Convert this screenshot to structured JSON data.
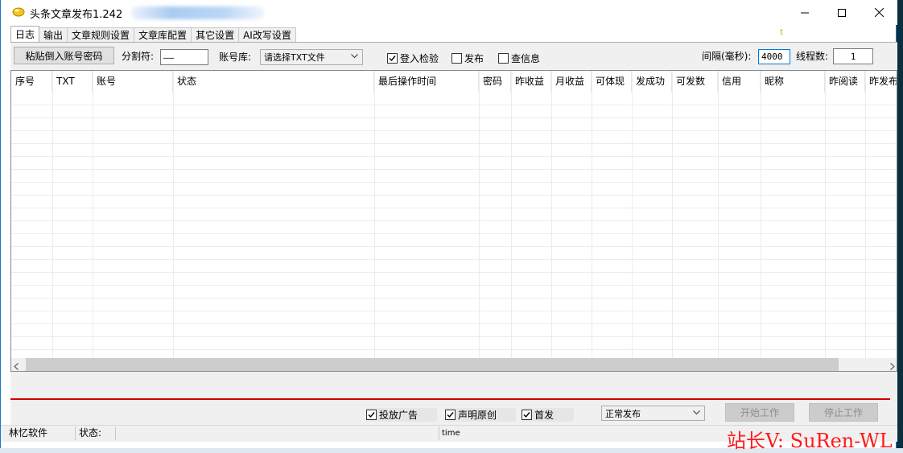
{
  "window": {
    "title": "头条文章发布1.242",
    "controls": [
      "minimize",
      "maximize",
      "close"
    ]
  },
  "tabs": [
    {
      "label": "日志",
      "active": true
    },
    {
      "label": "输出",
      "active": false
    },
    {
      "label": "文章规则设置",
      "active": false
    },
    {
      "label": "文章库配置",
      "active": false
    },
    {
      "label": "其它设置",
      "active": false
    },
    {
      "label": "AI改写设置",
      "active": false
    }
  ],
  "tab_marker": "t",
  "toolbar": {
    "paste_button": "粘贴倒入账号密码",
    "separator_label": "分割符:",
    "separator_value": "——",
    "account_lib_label": "账号库:",
    "account_lib_value": "请选择TXT文件",
    "login_check": {
      "label": "登入检验",
      "checked": true
    },
    "publish": {
      "label": "发布",
      "checked": false
    },
    "query_info": {
      "label": "查信息",
      "checked": false
    },
    "interval_label": "间隔(毫秒):",
    "interval_value": "4000",
    "threads_label": "线程数:",
    "threads_value": "1"
  },
  "table": {
    "columns": [
      "序号",
      "TXT",
      "账号",
      "状态",
      "最后操作时间",
      "密码",
      "昨收益",
      "月收益",
      "可体现",
      "发成功",
      "可发数",
      "信用",
      "昵称",
      "昨阅读",
      "昨发布"
    ],
    "rows": []
  },
  "bottom": {
    "ads": {
      "label": "投放广告",
      "checked": true
    },
    "declare_original": {
      "label": "声明原创",
      "checked": true
    },
    "first_publish": {
      "label": "首发",
      "checked": true
    },
    "mode_value": "正常发布",
    "start_button": "开始工作",
    "stop_button": "停止工作"
  },
  "statusbar": {
    "company": "林忆软件",
    "status_label": "状态:",
    "time_label": "time"
  },
  "watermark": "站长V: SuRen-WL",
  "colors": {
    "accent": "#0078d7",
    "separator_line": "#d00000",
    "watermark": "#ff1a1a"
  }
}
